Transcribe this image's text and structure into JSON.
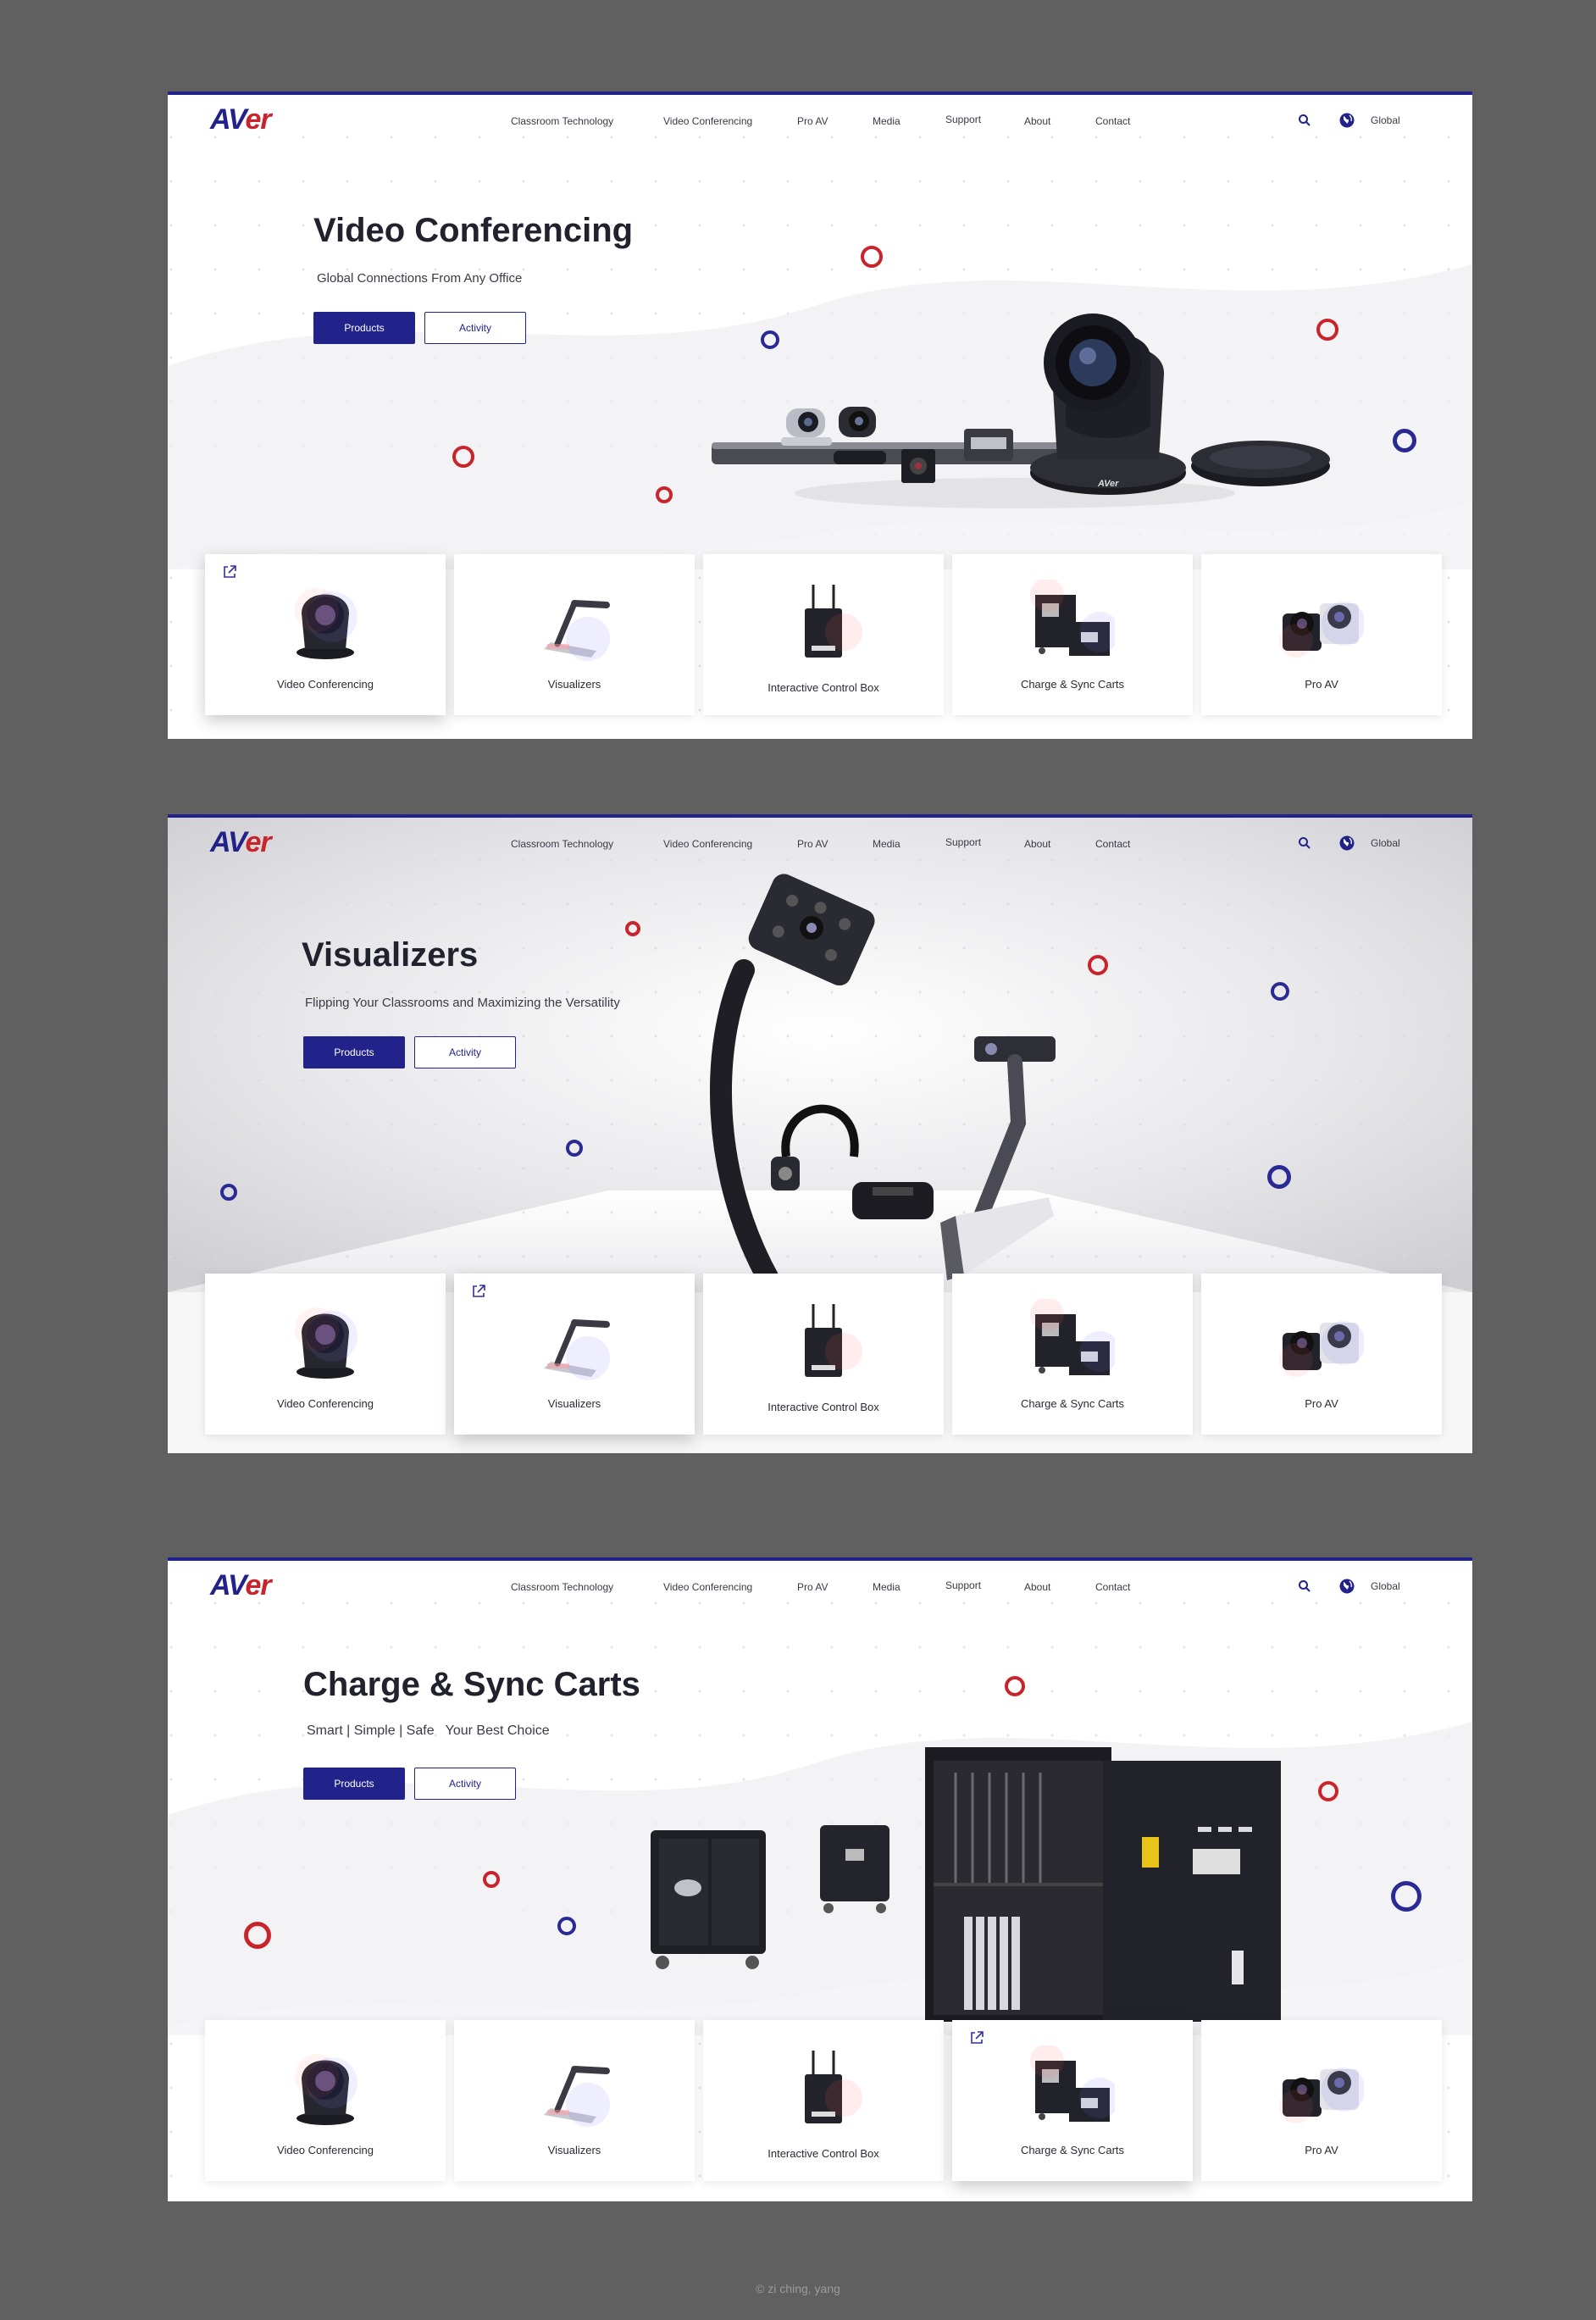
{
  "colors": {
    "page_background": "#606060",
    "brand_blue": "#22238a",
    "brand_red": "#c8242b"
  },
  "brand": {
    "logo_part1": "AV",
    "logo_part2": "er"
  },
  "nav": {
    "items": [
      "Classroom Technology",
      "Video Conferencing",
      "Pro AV",
      "Media",
      "Support",
      "About",
      "Contact"
    ],
    "search_icon": "search-icon",
    "globe_icon": "globe-icon",
    "language": "Global"
  },
  "product_cards": [
    {
      "label": "Video Conferencing",
      "icon": "conference-camera-icon"
    },
    {
      "label": "Visualizers",
      "icon": "visualizer-icon"
    },
    {
      "label": "Interactive Control Box",
      "icon": "control-box-icon"
    },
    {
      "label": "Charge & Sync Carts",
      "icon": "charge-cart-icon"
    },
    {
      "label": "Pro AV",
      "icon": "ptz-camera-icon"
    }
  ],
  "screens": [
    {
      "title": "Video Conferencing",
      "subtitle": "Global Connections From Any Office",
      "products_label": "Products",
      "activity_label": "Activity",
      "active_card": 0
    },
    {
      "title": "Visualizers",
      "subtitle": "Flipping Your Classrooms and Maximizing the Versatility",
      "products_label": "Products",
      "activity_label": "Activity",
      "active_card": 1
    },
    {
      "title": "Charge & Sync Carts",
      "subtitle": "Smart | Simple | Safe   Your Best Choice",
      "products_label": "Products",
      "activity_label": "Activity",
      "active_card": 3
    }
  ],
  "credit": "© zi ching, yang"
}
